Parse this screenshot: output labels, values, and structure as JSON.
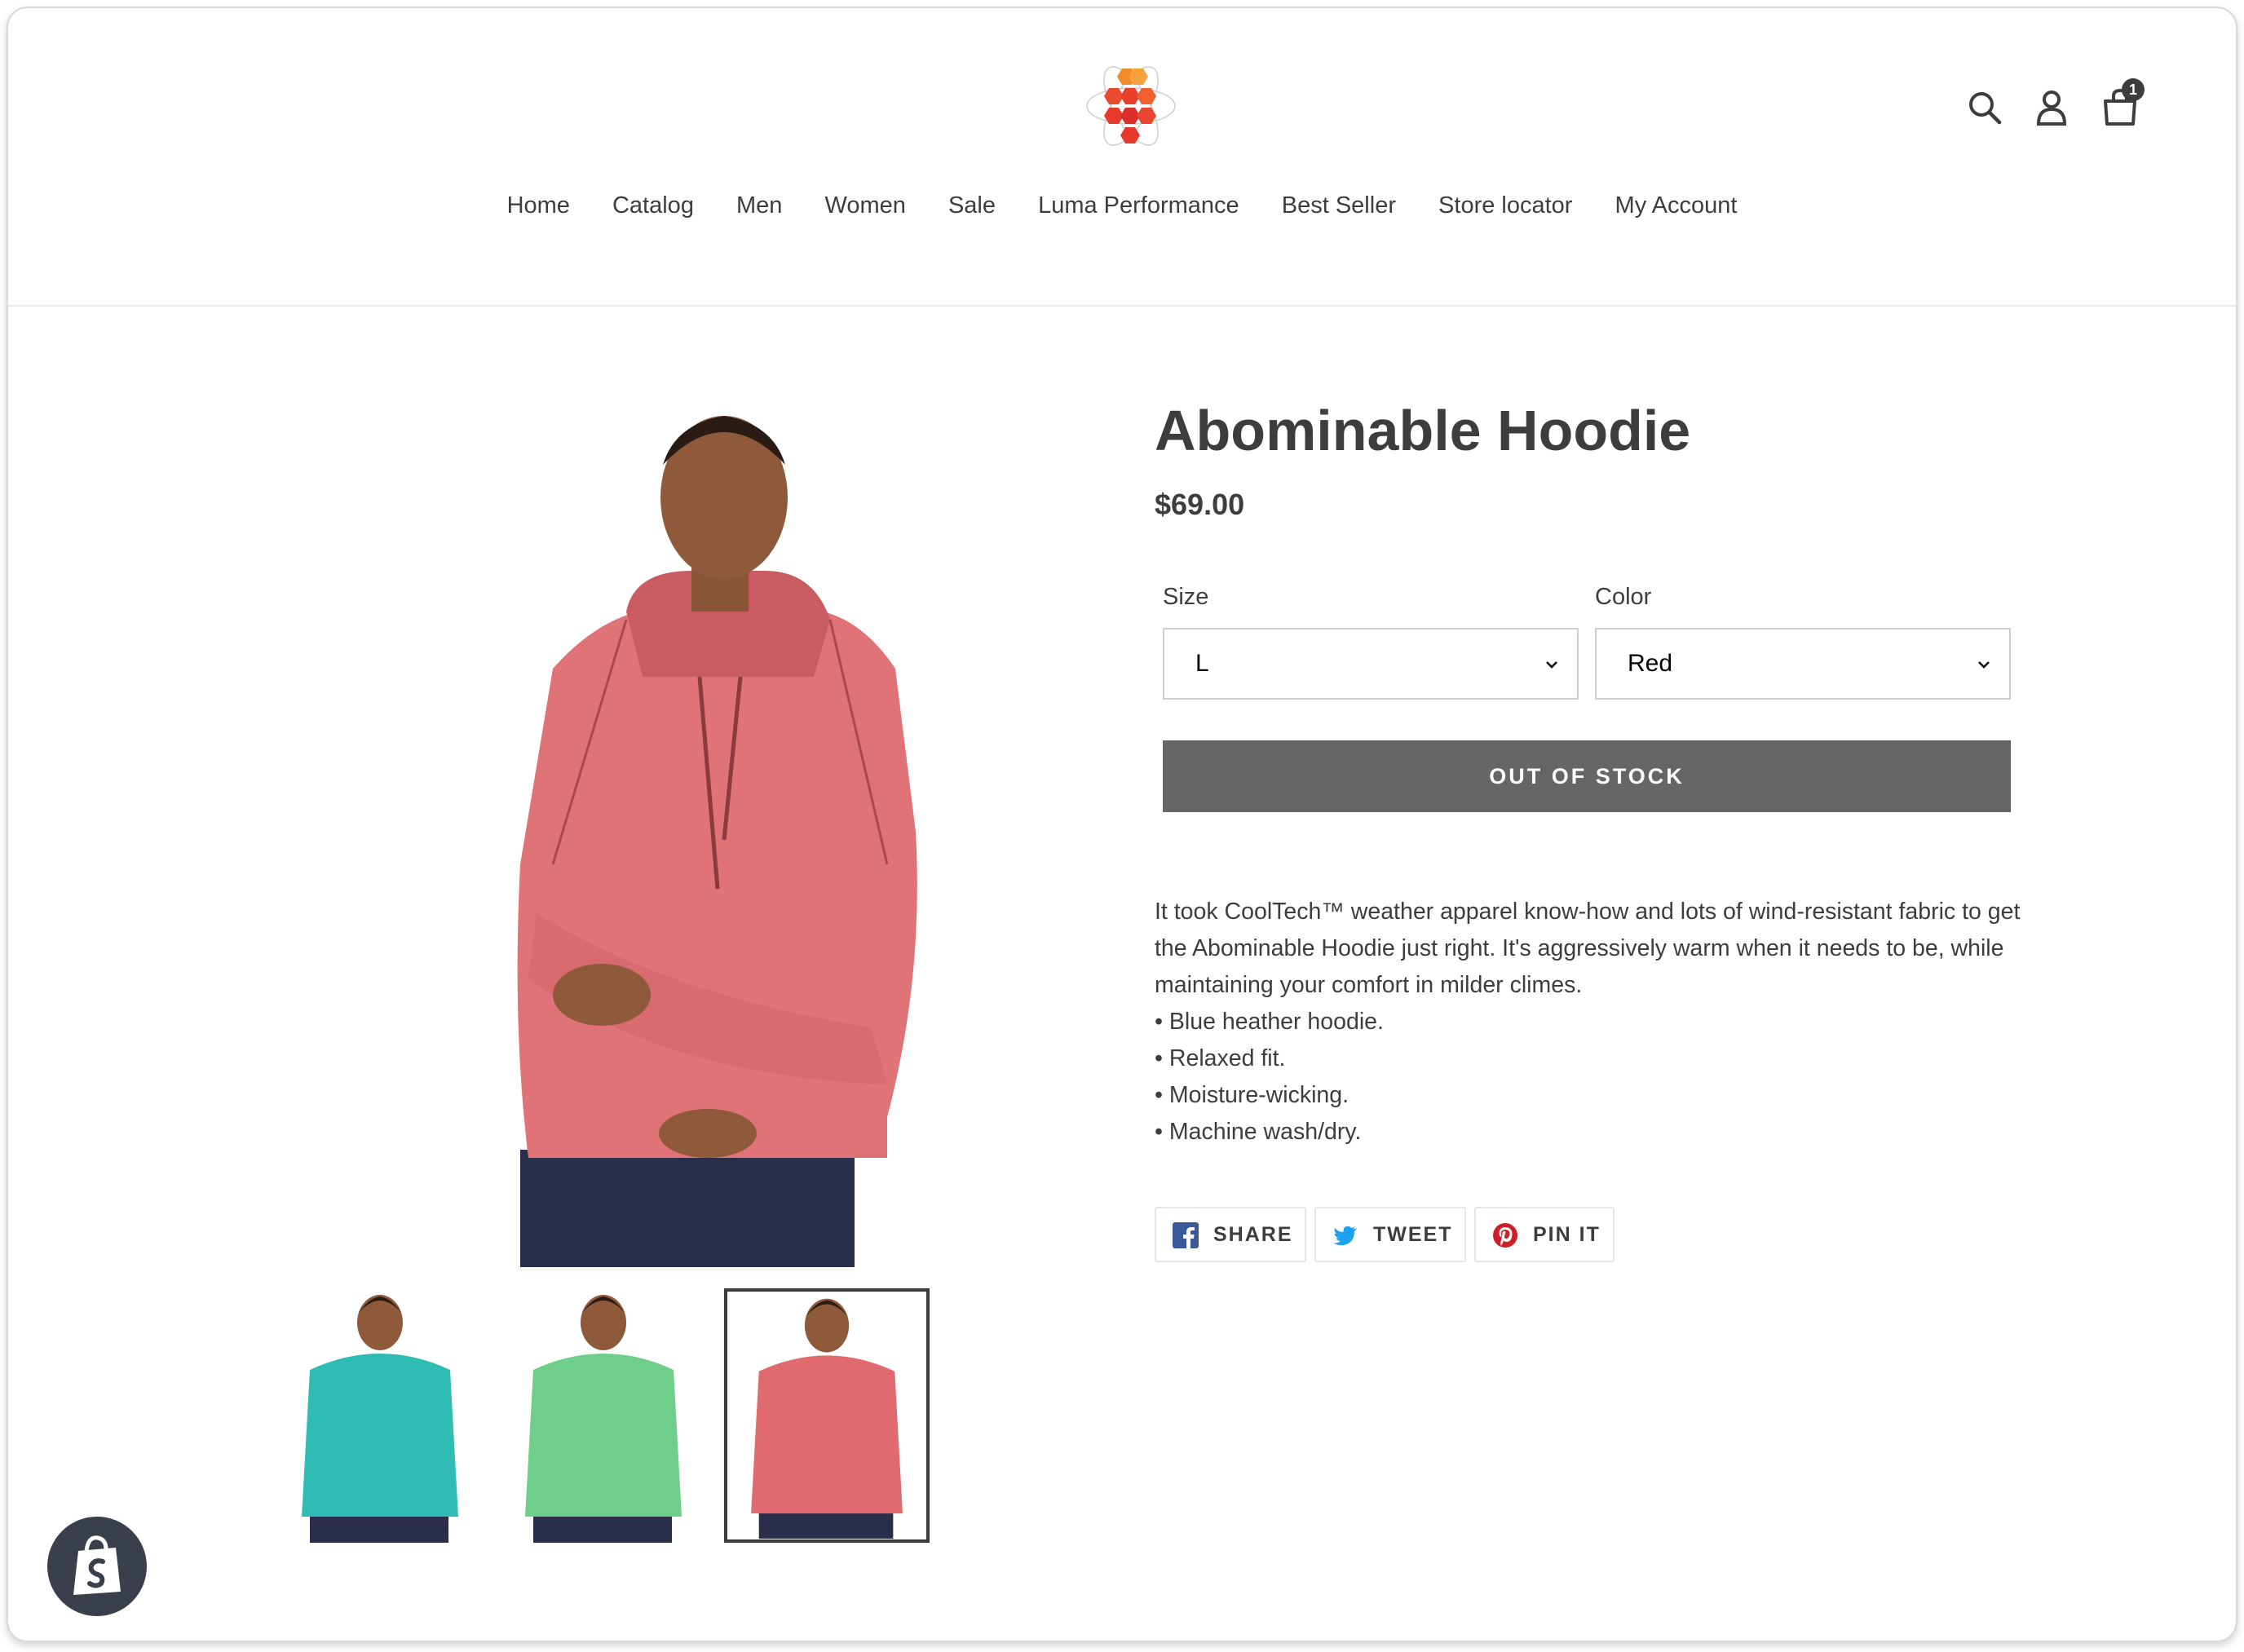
{
  "header": {
    "logo": "luma-logo",
    "icons": [
      "search-icon",
      "account-icon",
      "cart-icon"
    ],
    "cart_count": "1"
  },
  "nav": [
    "Home",
    "Catalog",
    "Men",
    "Women",
    "Sale",
    "Luma Performance",
    "Best Seller",
    "Store locator",
    "My Account"
  ],
  "product": {
    "title": "Abominable Hoodie",
    "price": "$69.00",
    "size_label": "Size",
    "size_value": "L",
    "color_label": "Color",
    "color_value": "Red",
    "button": "OUT OF STOCK",
    "description_lines": [
      "It took CoolTech™ weather apparel know-how and lots of wind-resistant fabric to get the Abominable Hoodie just right. It's aggressively warm when it needs to be, while maintaining your comfort in milder climes.",
      "• Blue heather hoodie.",
      "• Relaxed fit.",
      "• Moisture-wicking.",
      "• Machine wash/dry."
    ],
    "thumbnail_colors": [
      "#2ebcb4",
      "#6fcf8a",
      "#df6b70"
    ],
    "main_image_color": "#e07377"
  },
  "share": {
    "facebook": "SHARE",
    "twitter": "TWEET",
    "pinterest": "PIN IT"
  },
  "colors": {
    "button_bg": "#666666",
    "text": "#3d3d3d",
    "facebook": "#3b5998",
    "twitter": "#1da1f2",
    "pinterest": "#cb2027"
  }
}
